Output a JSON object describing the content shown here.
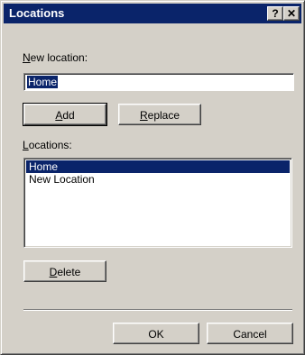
{
  "window": {
    "title": "Locations",
    "help_glyph": "?",
    "close_glyph": "✕"
  },
  "new_location": {
    "label_accel": "N",
    "label_rest": "ew location:",
    "value": "Home"
  },
  "buttons": {
    "add_accel": "A",
    "add_rest": "dd",
    "replace_accel": "R",
    "replace_rest": "eplace",
    "delete_accel": "D",
    "delete_rest": "elete",
    "ok": "OK",
    "cancel": "Cancel"
  },
  "locations": {
    "label_accel": "L",
    "label_rest": "ocations:",
    "items": [
      "Home",
      "New Location"
    ],
    "selected_index": 0
  },
  "colors": {
    "titlebar": "#0a246a",
    "face": "#d4d0c8",
    "selection": "#0a246a"
  }
}
